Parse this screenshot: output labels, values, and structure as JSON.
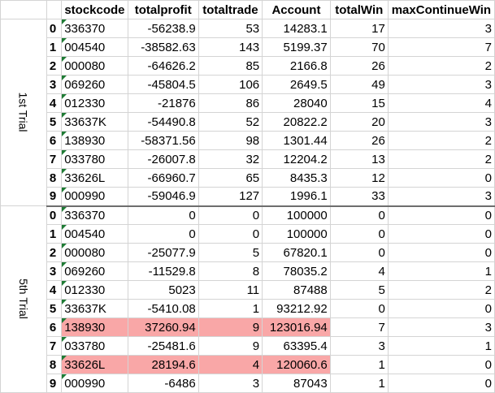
{
  "columns": [
    "stockcode",
    "totalprofit",
    "totaltrade",
    "Account",
    "totalWin",
    "maxContinueWin"
  ],
  "groups": [
    {
      "label": "1st Trial",
      "rows": [
        {
          "idx": "0",
          "stockcode": "336370",
          "totalprofit": "-56238.9",
          "totaltrade": "53",
          "Account": "14283.1",
          "totalWin": "17",
          "maxContinueWin": "3",
          "highlight": false
        },
        {
          "idx": "1",
          "stockcode": "004540",
          "totalprofit": "-38582.63",
          "totaltrade": "143",
          "Account": "5199.37",
          "totalWin": "70",
          "maxContinueWin": "7",
          "highlight": false
        },
        {
          "idx": "2",
          "stockcode": "000080",
          "totalprofit": "-64626.2",
          "totaltrade": "85",
          "Account": "2166.8",
          "totalWin": "26",
          "maxContinueWin": "2",
          "highlight": false
        },
        {
          "idx": "3",
          "stockcode": "069260",
          "totalprofit": "-45804.5",
          "totaltrade": "106",
          "Account": "2649.5",
          "totalWin": "49",
          "maxContinueWin": "3",
          "highlight": false
        },
        {
          "idx": "4",
          "stockcode": "012330",
          "totalprofit": "-21876",
          "totaltrade": "86",
          "Account": "28040",
          "totalWin": "15",
          "maxContinueWin": "4",
          "highlight": false
        },
        {
          "idx": "5",
          "stockcode": "33637K",
          "totalprofit": "-54490.8",
          "totaltrade": "52",
          "Account": "20822.2",
          "totalWin": "20",
          "maxContinueWin": "3",
          "highlight": false
        },
        {
          "idx": "6",
          "stockcode": "138930",
          "totalprofit": "-58371.56",
          "totaltrade": "98",
          "Account": "1301.44",
          "totalWin": "26",
          "maxContinueWin": "2",
          "highlight": false
        },
        {
          "idx": "7",
          "stockcode": "033780",
          "totalprofit": "-26007.8",
          "totaltrade": "32",
          "Account": "12204.2",
          "totalWin": "13",
          "maxContinueWin": "2",
          "highlight": false
        },
        {
          "idx": "8",
          "stockcode": "33626L",
          "totalprofit": "-66960.7",
          "totaltrade": "65",
          "Account": "8435.3",
          "totalWin": "12",
          "maxContinueWin": "0",
          "highlight": false
        },
        {
          "idx": "9",
          "stockcode": "000990",
          "totalprofit": "-59046.9",
          "totaltrade": "127",
          "Account": "1996.1",
          "totalWin": "33",
          "maxContinueWin": "3",
          "highlight": false
        }
      ]
    },
    {
      "label": "5th Trial",
      "rows": [
        {
          "idx": "0",
          "stockcode": "336370",
          "totalprofit": "0",
          "totaltrade": "0",
          "Account": "100000",
          "totalWin": "0",
          "maxContinueWin": "0",
          "highlight": false
        },
        {
          "idx": "1",
          "stockcode": "004540",
          "totalprofit": "0",
          "totaltrade": "0",
          "Account": "100000",
          "totalWin": "0",
          "maxContinueWin": "0",
          "highlight": false
        },
        {
          "idx": "2",
          "stockcode": "000080",
          "totalprofit": "-25077.9",
          "totaltrade": "5",
          "Account": "67820.1",
          "totalWin": "0",
          "maxContinueWin": "0",
          "highlight": false
        },
        {
          "idx": "3",
          "stockcode": "069260",
          "totalprofit": "-11529.8",
          "totaltrade": "8",
          "Account": "78035.2",
          "totalWin": "4",
          "maxContinueWin": "1",
          "highlight": false
        },
        {
          "idx": "4",
          "stockcode": "012330",
          "totalprofit": "5023",
          "totaltrade": "11",
          "Account": "87488",
          "totalWin": "5",
          "maxContinueWin": "2",
          "highlight": false
        },
        {
          "idx": "5",
          "stockcode": "33637K",
          "totalprofit": "-5410.08",
          "totaltrade": "1",
          "Account": "93212.92",
          "totalWin": "0",
          "maxContinueWin": "0",
          "highlight": false
        },
        {
          "idx": "6",
          "stockcode": "138930",
          "totalprofit": "37260.94",
          "totaltrade": "9",
          "Account": "123016.94",
          "totalWin": "7",
          "maxContinueWin": "3",
          "highlight": true
        },
        {
          "idx": "7",
          "stockcode": "033780",
          "totalprofit": "-25481.6",
          "totaltrade": "9",
          "Account": "63395.4",
          "totalWin": "3",
          "maxContinueWin": "1",
          "highlight": false
        },
        {
          "idx": "8",
          "stockcode": "33626L",
          "totalprofit": "28194.6",
          "totaltrade": "4",
          "Account": "120060.6",
          "totalWin": "1",
          "maxContinueWin": "0",
          "highlight": true
        },
        {
          "idx": "9",
          "stockcode": "000990",
          "totalprofit": "-6486",
          "totaltrade": "3",
          "Account": "87043",
          "totalWin": "1",
          "maxContinueWin": "0",
          "highlight": false
        }
      ]
    }
  ],
  "colors": {
    "highlight": "#f9a7a7",
    "corner_marker": "#1e7b34"
  }
}
